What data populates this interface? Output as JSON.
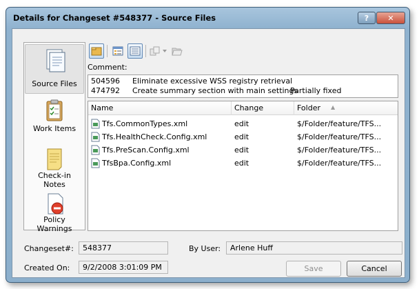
{
  "window": {
    "title": "Details for Changeset #548377 - Source Files",
    "help_label": "?",
    "close_label": "✕"
  },
  "sidebar": {
    "items": [
      {
        "label": "Source Files",
        "icon": "source-files-icon",
        "selected": true
      },
      {
        "label": "Work Items",
        "icon": "work-items-icon"
      },
      {
        "label": "Check-in Notes",
        "icon": "checkin-notes-icon"
      },
      {
        "label": "Policy Warnings",
        "icon": "policy-warnings-icon"
      }
    ]
  },
  "toolbar": {
    "icons": [
      "folder-view-icon",
      "details-view-icon",
      "list-view-icon",
      "compare-icon",
      "dropdown-arrow-icon",
      "open-folder-icon"
    ]
  },
  "comment": {
    "label": "Comment:",
    "work_items": [
      {
        "id": "504596",
        "title": "Eliminate excessive WSS registry retrieval",
        "state": ""
      },
      {
        "id": "474792",
        "title": "Create summary section with main settings",
        "state": "Partially fixed"
      }
    ]
  },
  "files": {
    "columns": [
      "Name",
      "Change",
      "Folder"
    ],
    "sort_indicator": "▲",
    "rows": [
      {
        "name": "Tfs.CommonTypes.xml",
        "change": "edit",
        "folder": "$/Folder/feature/TFS..."
      },
      {
        "name": "Tfs.HealthCheck.Config.xml",
        "change": "edit",
        "folder": "$/Folder/feature/TFS..."
      },
      {
        "name": "Tfs.PreScan.Config.xml",
        "change": "edit",
        "folder": "$/Folder/feature/TFS..."
      },
      {
        "name": "TfsBpa.Config.xml",
        "change": "edit",
        "folder": "$/Folder/feature/TFS..."
      }
    ]
  },
  "details": {
    "changeset_label": "Changeset#:",
    "changeset_value": "548377",
    "user_label": "By User:",
    "user_value": "Arlene Huff",
    "created_label": "Created On:",
    "created_value": "9/2/2008 3:01:09 PM"
  },
  "buttons": {
    "save": "Save",
    "cancel": "Cancel"
  }
}
